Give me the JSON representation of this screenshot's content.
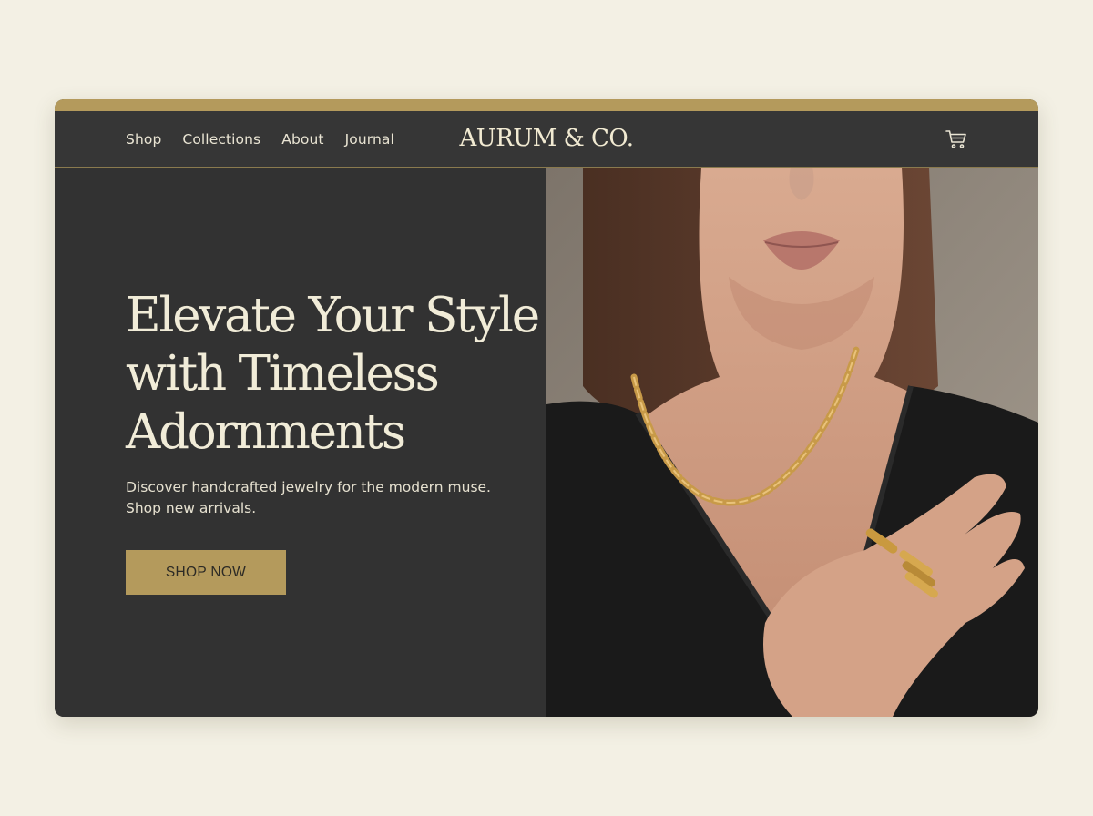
{
  "nav": {
    "links": [
      "Shop",
      "Collections",
      "About",
      "Journal"
    ],
    "brand": "AURUM & CO.",
    "cart_icon": "shopping-cart-icon"
  },
  "hero": {
    "headline": "Elevate Your Style with Timeless Adornments",
    "subtext_line1": "Discover handcrafted jewelry for the modern muse.",
    "subtext_line2": "Shop new arrivals.",
    "cta_label": "SHOP NOW",
    "image_subject": "woman wearing gold chain necklace and stacked gold rings"
  },
  "colors": {
    "page_background": "#f3f0e4",
    "panel_dark": "#323232",
    "gold_accent": "#b49a5c",
    "cream_text": "#f1ecd8"
  }
}
